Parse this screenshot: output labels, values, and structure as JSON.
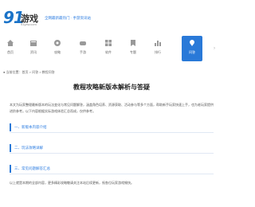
{
  "header": {
    "logo_number": "91",
    "logo_word": "游戏",
    "logo_sub": "91yxw.com",
    "slogan": "全网最新最热门 · 手游资讯站"
  },
  "nav": {
    "items": [
      {
        "label": "首页",
        "icon": "home-icon"
      },
      {
        "label": "资讯",
        "icon": "news-icon"
      },
      {
        "label": "攻略",
        "icon": "guide-icon"
      },
      {
        "label": "手游",
        "icon": "gamepad-icon"
      },
      {
        "label": "软件",
        "icon": "app-icon"
      },
      {
        "label": "专题",
        "icon": "topic-icon"
      },
      {
        "label": "排行",
        "icon": "rank-icon"
      },
      {
        "label": "合集",
        "icon": "collection-icon"
      },
      {
        "label": "问答",
        "icon": "qa-icon",
        "active": true
      }
    ],
    "more": "›"
  },
  "breadcrumb": "● 当前位置：首页 > 问答 > 教程问答",
  "article": {
    "title": "教程攻略新版本解析与答疑",
    "intro": "本文为玩家整理最新版本的玩法变化与常见问题解答，涵盖角色培养、资源获取、活动参与等多个方面，帮助新手玩家快速上手，也为老玩家提供进阶参考。以下内容根据实际游戏体验汇总而成，仅供参考。",
    "sections": [
      "一、新版本内容介绍",
      "二、玩法攻略详解",
      "三、常见问题解答汇总"
    ],
    "outro": "以上就是本期的全部内容，更多精彩攻略敬请关注本站后续更新，祝各位玩家游戏愉快。"
  },
  "colors": {
    "brand": "#1a73c8",
    "accent": "#2979d8"
  }
}
